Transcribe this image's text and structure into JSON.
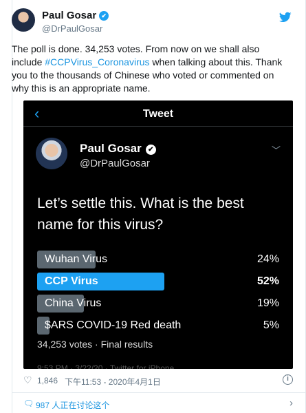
{
  "author": {
    "name": "Paul Gosar",
    "handle": "@DrPaulGosar"
  },
  "tweet": {
    "text_before": "The poll is done.  34,253 votes.  From now on we shall also include ",
    "hashtag": "#CCPVirus_Coronavirus",
    "text_after": " when talking about this.  Thank you to the thousands of Chinese who voted or commented on why this is an appropriate name."
  },
  "embed": {
    "bar_title": "Tweet",
    "author_name": "Paul Gosar",
    "author_handle": "@DrPaulGosar",
    "question": "Let’s settle this. What is the best name for this virus?",
    "poll": [
      {
        "label": "Wuhan Virus",
        "percent": "24%",
        "fraction": 0.24,
        "winner": false
      },
      {
        "label": "CCP Virus",
        "percent": "52%",
        "fraction": 0.52,
        "winner": true
      },
      {
        "label": "China Virus",
        "percent": "19%",
        "fraction": 0.19,
        "winner": false
      },
      {
        "label": "$ARS COVID-19 Red death",
        "percent": "5%",
        "fraction": 0.05,
        "winner": false
      }
    ],
    "footer": "34,253 votes · Final results",
    "cutoff_text": "9:53 PM · 3/22/20 · Twitter for iPhone"
  },
  "meta": {
    "likes": "1,846",
    "timestamp": "下午11:53 - 2020年4月1日"
  },
  "discussion": {
    "text": "987 人正在讨论这个"
  },
  "colors": {
    "accent": "#1da1f2",
    "link": "#1b95e0",
    "poll_bar": "#5b6770",
    "embed_bg": "#000000"
  },
  "icons": {
    "brand": "twitter-bird-icon",
    "verified": "verified-badge-icon",
    "back": "chevron-left-icon",
    "menu": "chevron-down-icon",
    "like": "heart-icon",
    "info": "info-icon",
    "comment": "comment-icon",
    "more": "chevron-right-icon"
  }
}
